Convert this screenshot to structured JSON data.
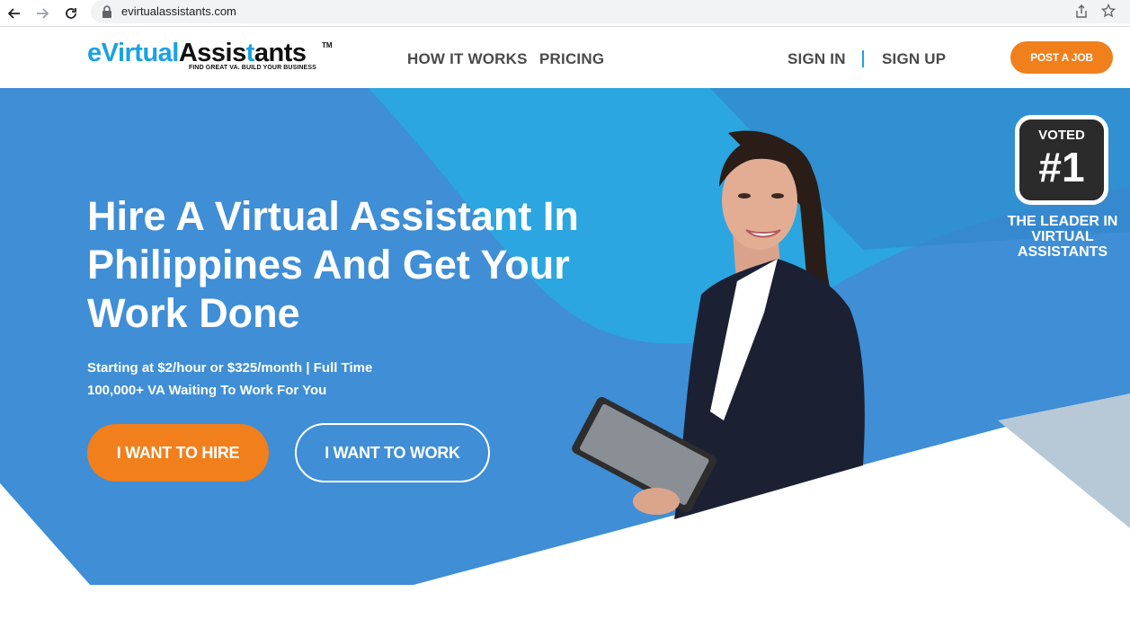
{
  "browser": {
    "url": "evirtualassistants.com"
  },
  "header": {
    "logo": {
      "e": "e",
      "virtual": "Virtual",
      "assis": "Assis",
      "t": "t",
      "ants": "ants",
      "tm": "TM",
      "tagline": "FIND GREAT VA. BUILD YOUR BUSINESS"
    },
    "nav": {
      "how_it_works": "HOW IT WORKS",
      "pricing": "PRICING",
      "sign_in": "SIGN IN",
      "sign_up": "SIGN UP",
      "post_job": "POST A JOB"
    }
  },
  "hero": {
    "title": "Hire A Virtual Assistant In Philippines And Get Your Work Done",
    "subtitle_line1": "Starting at $2/hour or $325/month | Full Time",
    "subtitle_line2": "100,000+ VA Waiting To Work For You",
    "hire_button": "I WANT TO HIRE",
    "work_button": "I WANT TO WORK",
    "badge": {
      "voted": "VOTED",
      "rank": "#1",
      "leader_text": "THE LEADER IN VIRTUAL ASSISTANTS"
    }
  },
  "colors": {
    "brand_blue": "#1ba1e2",
    "hero_blue": "#3e8fd6",
    "orange": "#f07f1c",
    "badge_dark": "#2b2b2b"
  },
  "icons": [
    "back-arrow-icon",
    "forward-arrow-icon",
    "reload-icon",
    "lock-icon",
    "share-icon",
    "star-icon"
  ]
}
